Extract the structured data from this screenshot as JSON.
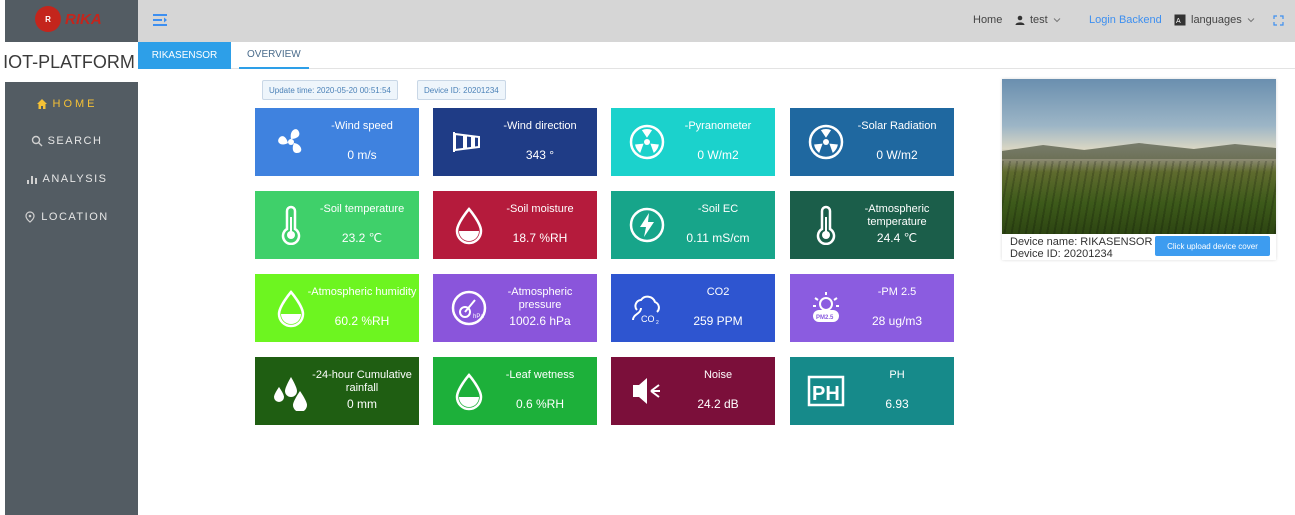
{
  "brand": {
    "logo_text": "RIKA",
    "title": "IOT-PLATFORM"
  },
  "nav": [
    {
      "label": "HOME",
      "icon": "home-icon",
      "active": true
    },
    {
      "label": "SEARCH",
      "icon": "search-icon",
      "active": false
    },
    {
      "label": "ANALYSIS",
      "icon": "bar-chart-icon",
      "active": false
    },
    {
      "label": "LOCATION",
      "icon": "location-pin-icon",
      "active": false
    }
  ],
  "header": {
    "home": "Home",
    "user": "test",
    "login_backend": "Login Backend",
    "languages": "languages"
  },
  "tabs": [
    {
      "label": "RIKASENSOR",
      "active": true
    },
    {
      "label": "OVERVIEW",
      "active": false
    }
  ],
  "info": {
    "update_time": "Update time: 2020-05-20 00:51:54",
    "device_id": "Device ID: 20201234"
  },
  "sensors": [
    {
      "label": "-Wind speed",
      "value": "0 m/s",
      "color": "#3f82df",
      "icon": "fan-icon"
    },
    {
      "label": "-Wind direction",
      "value": "343 °",
      "color": "#1f3c86",
      "icon": "windsock-icon"
    },
    {
      "label": "-Pyranometer",
      "value": "0 W/m2",
      "color": "#1bd2cc",
      "icon": "radiation-icon"
    },
    {
      "label": "-Solar Radiation",
      "value": "0 W/m2",
      "color": "#1f68a0",
      "icon": "radiation-icon"
    },
    {
      "label": "-Soil temperature",
      "value": "23.2 ℃",
      "color": "#3fd06a",
      "icon": "thermometer-icon"
    },
    {
      "label": "-Soil moisture",
      "value": "18.7 %RH",
      "color": "#b51b3c",
      "icon": "droplet-icon"
    },
    {
      "label": "-Soil EC",
      "value": "0.11 mS/cm",
      "color": "#17a58a",
      "icon": "lightning-icon"
    },
    {
      "label": "-Atmospheric temperature",
      "value": "24.4 ℃",
      "color": "#1b5e4a",
      "icon": "thermometer-icon"
    },
    {
      "label": "-Atmospheric humidity",
      "value": "60.2 %RH",
      "color": "#6df520",
      "icon": "droplet-icon"
    },
    {
      "label": "-Atmospheric pressure",
      "value": "1002.6 hPa",
      "color": "#8a55db",
      "icon": "pressure-gauge-icon"
    },
    {
      "label": "CO2",
      "value": "259 PPM",
      "color": "#2e55d0",
      "icon": "co2-cloud-icon"
    },
    {
      "label": "-PM 2.5",
      "value": "28 ug/m3",
      "color": "#8b5ce0",
      "icon": "pm25-icon"
    },
    {
      "label": "-24-hour Cumulative rainfall",
      "value": "0 mm",
      "color": "#1f5e12",
      "icon": "raindrops-icon"
    },
    {
      "label": "-Leaf wetness",
      "value": "0.6 %RH",
      "color": "#1db03a",
      "icon": "droplet-icon"
    },
    {
      "label": "Noise",
      "value": "24.2 dB",
      "color": "#7b0f3a",
      "icon": "speaker-icon"
    },
    {
      "label": "PH",
      "value": "6.93",
      "color": "#168a8a",
      "icon": "ph-icon"
    }
  ],
  "device": {
    "name": "Device name: RIKASENSOR",
    "id": "Device ID: 20201234",
    "upload_label": "Click upload device cover"
  }
}
